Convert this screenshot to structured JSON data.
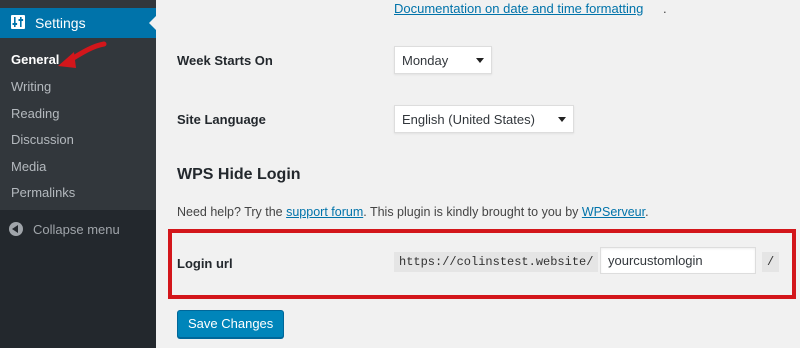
{
  "sidebar": {
    "menu_title": "Settings",
    "icon": "settings-sliders-icon",
    "items": [
      {
        "label": "General",
        "current": true
      },
      {
        "label": "Writing"
      },
      {
        "label": "Reading"
      },
      {
        "label": "Discussion"
      },
      {
        "label": "Media"
      },
      {
        "label": "Permalinks"
      }
    ],
    "collapse_label": "Collapse menu"
  },
  "main": {
    "doc_link": "Documentation on date and time formatting",
    "doc_link_tail": ".",
    "week_starts": {
      "label": "Week Starts On",
      "value": "Monday"
    },
    "site_language": {
      "label": "Site Language",
      "value": "English (United States)"
    },
    "section_title": "WPS Hide Login",
    "help": {
      "prefix": "Need help? Try the ",
      "forum_link": "support forum",
      "middle": ". This plugin is kindly brought to you by ",
      "author_link": "WPServeur",
      "suffix": "."
    },
    "login_url": {
      "label": "Login url",
      "prefix": "https://colinstest.website/",
      "value": "yourcustomlogin",
      "suffix": "/"
    },
    "save_button": "Save Changes"
  },
  "colors": {
    "accent": "#0073aa",
    "highlight_box": "#d3161b",
    "sidebar_bg": "#23282d"
  }
}
